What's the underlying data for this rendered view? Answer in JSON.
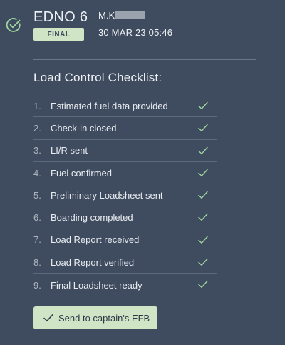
{
  "header": {
    "flight": "EDNO 6",
    "status_badge": "FINAL",
    "user_prefix": "M.K",
    "datetime": "30 MAR 23 05:46"
  },
  "checklist": {
    "title": "Load Control Checklist:",
    "items": [
      {
        "num": "1.",
        "label": "Estimated fuel data provided",
        "done": true
      },
      {
        "num": "2.",
        "label": "Check-in closed",
        "done": true
      },
      {
        "num": "3.",
        "label": "LI/R sent",
        "done": true
      },
      {
        "num": "4.",
        "label": "Fuel confirmed",
        "done": true
      },
      {
        "num": "5.",
        "label": "Preliminary Loadsheet sent",
        "done": true
      },
      {
        "num": "6.",
        "label": "Boarding completed",
        "done": true
      },
      {
        "num": "7.",
        "label": "Load Report received",
        "done": true
      },
      {
        "num": "8.",
        "label": "Load Report verified",
        "done": true
      },
      {
        "num": "9.",
        "label": "Final Loadsheet ready",
        "done": true
      }
    ]
  },
  "actions": {
    "send_label": "Send to captain's EFB"
  },
  "colors": {
    "background": "#3f4b5e",
    "accent_green": "#cfe5c6",
    "check_green": "#9fd6a0"
  }
}
